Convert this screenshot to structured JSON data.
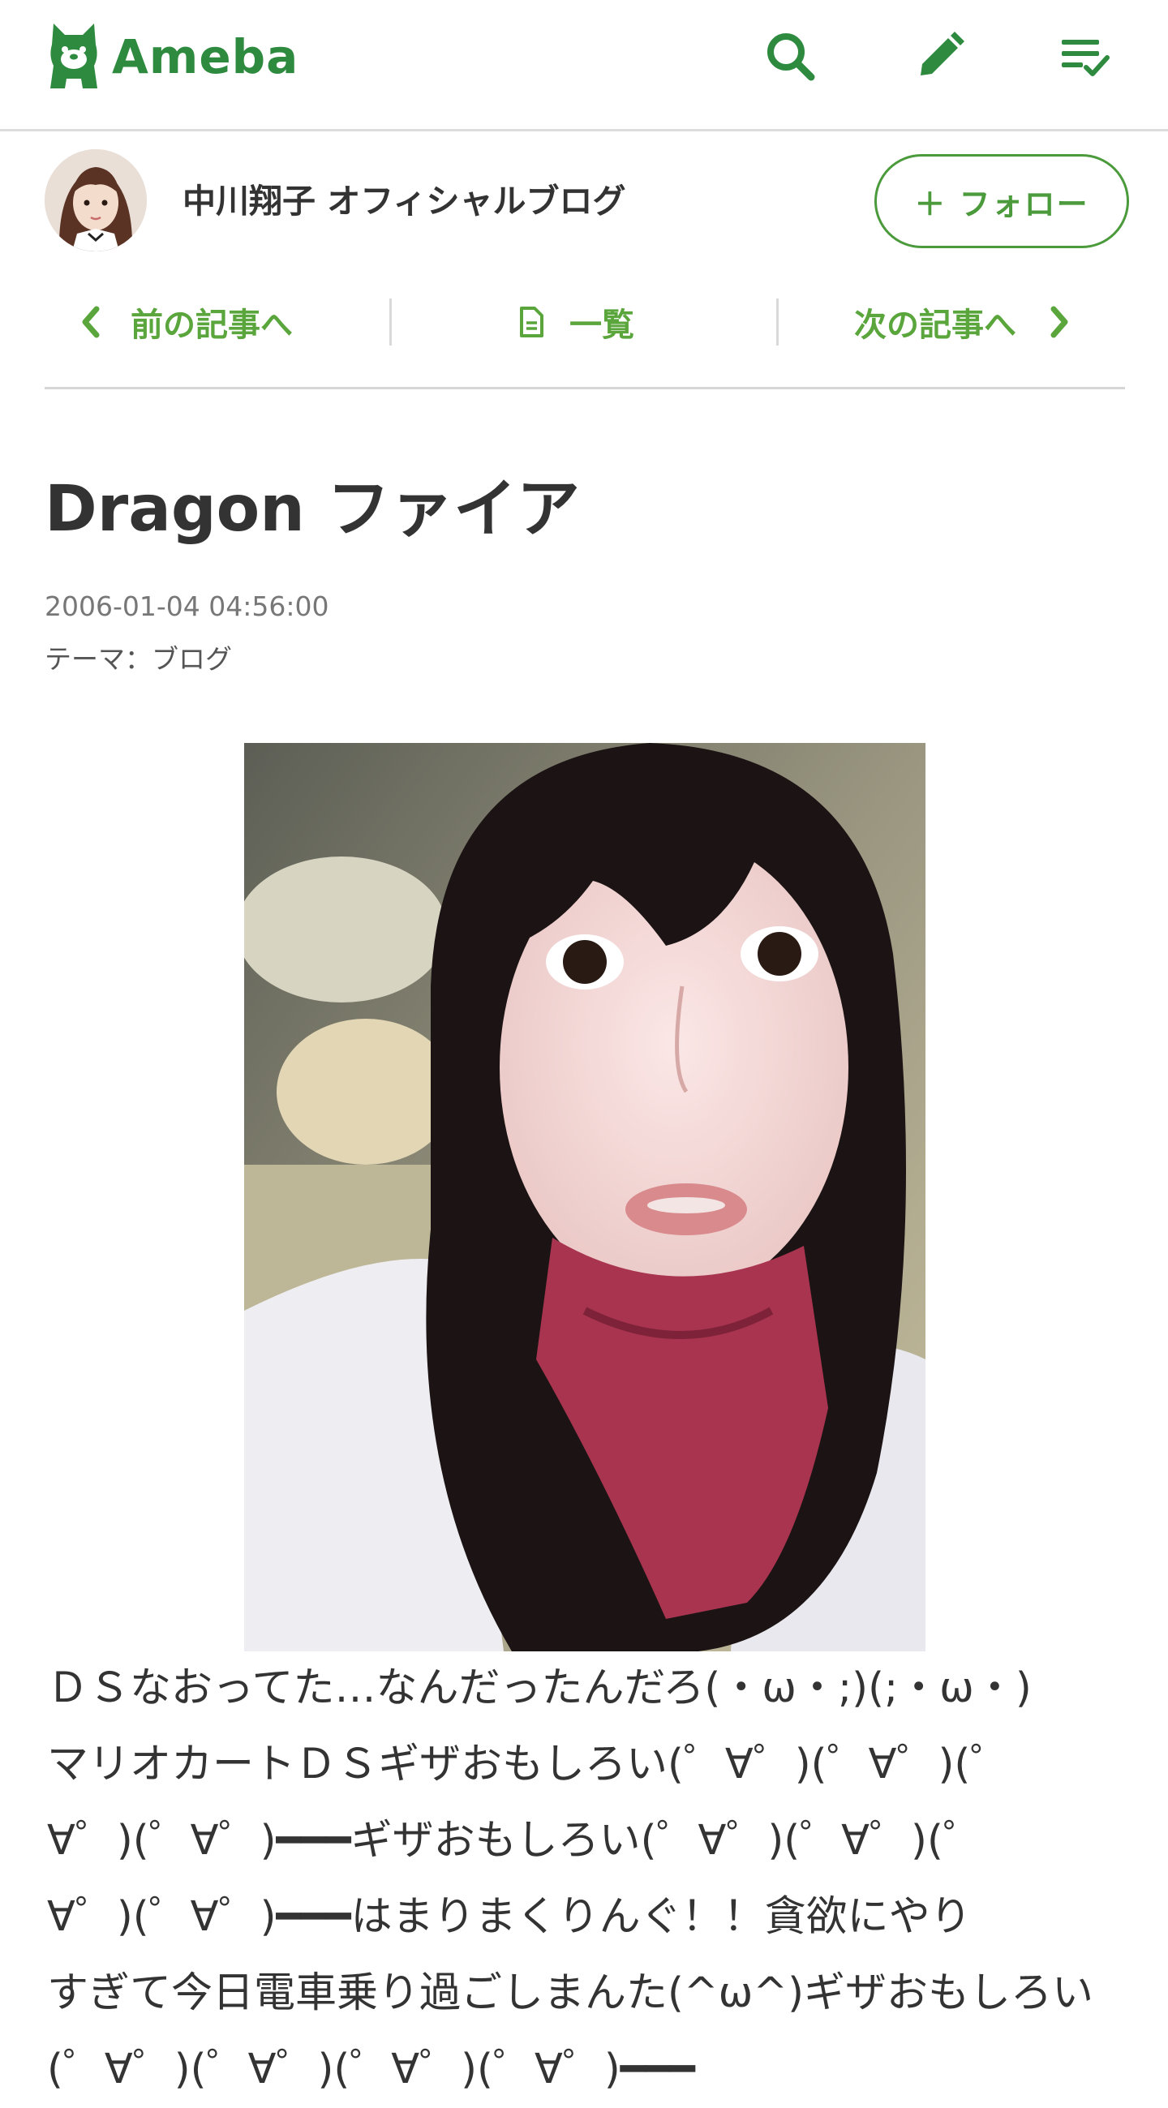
{
  "header": {
    "logo_text": "Ameba",
    "icons": {
      "search": "search-icon",
      "edit": "pencil-icon",
      "menu": "checklist-icon"
    },
    "brand_color": "#2d8a3e"
  },
  "blog": {
    "title": "中川翔子 オフィシャルブログ",
    "follow_label": "＋ フォロー"
  },
  "article_nav": {
    "prev_label": "前の記事へ",
    "list_label": "一覧",
    "next_label": "次の記事へ",
    "accent_color": "#5aa63d"
  },
  "entry": {
    "title": "Dragon ファイア",
    "date": "2006-01-04 04:56:00",
    "theme": "テーマ：ブログ",
    "body_lines": [
      "ＤＳなおってた…なんだったんだろ(・ω・;)(;・ω・)",
      "マリオカートＤＳギザおもしろい(゜∀゜)(゜∀゜)(゜",
      "∀゜)(゜∀゜)━━━ギザおもしろい(゜∀゜)(゜∀゜)(゜",
      "∀゜)(゜∀゜)━━━はまりまくりんぐ！！貪欲にやり",
      "すぎて今日電車乗り過ごしまんた(^ω^)ギザおもしろい",
      "(゜∀゜)(゜∀゜)(゜∀゜)(゜∀゜)━━━"
    ]
  }
}
